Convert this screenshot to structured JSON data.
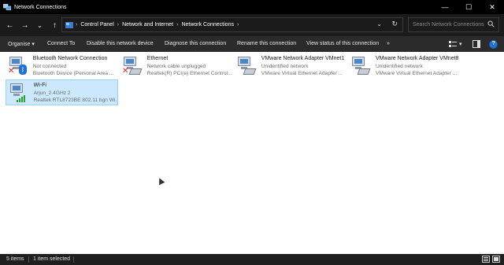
{
  "window": {
    "title": "Network Connections",
    "controls": {
      "minimize": "—",
      "maximize": "☐",
      "close": "✕"
    }
  },
  "nav": {
    "back": "←",
    "forward": "→",
    "recent": "⌄",
    "up": "↑",
    "breadcrumb": [
      "Control Panel",
      "Network and Internet",
      "Network Connections"
    ],
    "separator": "›",
    "dropdown": "⌄",
    "refresh": "↻",
    "search_placeholder": "Search Network Connections"
  },
  "toolbar": {
    "organise": "Organise ▾",
    "connect_to": "Connect To",
    "disable": "Disable this network device",
    "diagnose": "Diagnose this connection",
    "rename": "Rename this connection",
    "view_status": "View status of this connection",
    "more": "»",
    "view_dropdown": "▾",
    "help": "?"
  },
  "connections": [
    {
      "name": "Bluetooth Network Connection",
      "status": "Not connected",
      "device": "Bluetooth Device (Personal Area ...",
      "icon": "bluetooth-adapter-icon",
      "state": "disconnected"
    },
    {
      "name": "Ethernet",
      "status": "Network cable unplugged",
      "device": "Realtek(R) PCI(e) Ethernet Control...",
      "icon": "ethernet-adapter-icon",
      "state": "disconnected"
    },
    {
      "name": "VMware Network Adapter VMnet1",
      "status": "Unidentified network",
      "device": "VMware Virtual Ethernet Adapter ...",
      "icon": "ethernet-adapter-icon",
      "state": "connected"
    },
    {
      "name": "VMware Network Adapter VMnet8",
      "status": "Unidentified network",
      "device": "VMware Virtual Ethernet Adapter ...",
      "icon": "ethernet-adapter-icon",
      "state": "connected"
    },
    {
      "name": "Wi-Fi",
      "status": "Arjun_2.4GHz 2",
      "device": "Realtek RTL8723BE 802.11 bgn Wi...",
      "icon": "wifi-adapter-icon",
      "state": "connected"
    }
  ],
  "status": {
    "count": "5 items",
    "selected": "1 item selected"
  },
  "colors": {
    "accent_selected": "#cce8ff",
    "dark_chrome": "#000000",
    "error_x": "#e02020",
    "signal_green": "#2aa12a"
  }
}
